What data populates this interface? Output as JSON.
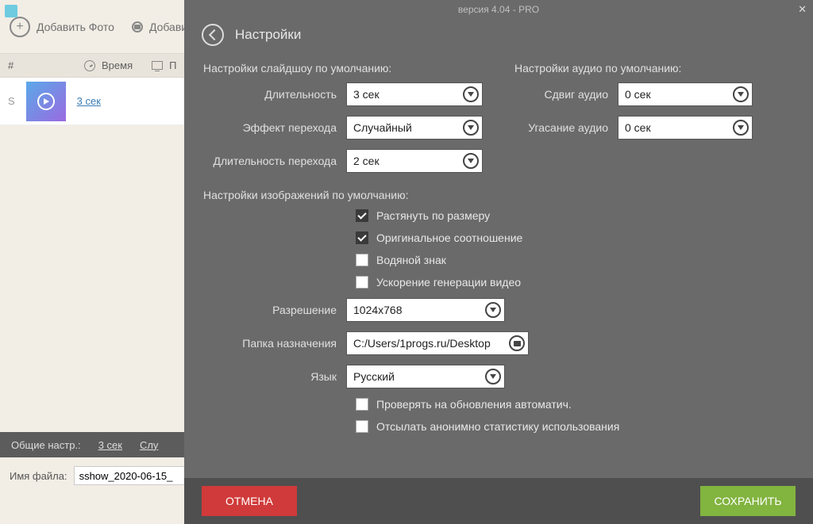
{
  "titlebar": {
    "version": "версия 4.04 - PRO"
  },
  "header": {
    "title": "Настройки"
  },
  "background": {
    "toolbar": {
      "add_photo": "Добавить Фото",
      "add_other": "Добавит"
    },
    "table": {
      "hash": "#",
      "time_hdr": "Время",
      "mon_hdr": "П",
      "row_num": "S",
      "row_time": "3 сек"
    },
    "bottombar": {
      "label": "Общие настр.:",
      "val1": "3 сек",
      "val2": "Слу"
    },
    "filerow": {
      "label": "Имя файла:",
      "value": "sshow_2020-06-15_"
    }
  },
  "sections": {
    "slideshow_title": "Настройки слайдшоу по умолчанию:",
    "audio_title": "Настройки аудио по умолчанию:",
    "images_title": "Настройки изображений по умолчанию:"
  },
  "labels": {
    "duration": "Длительность",
    "transition_effect": "Эффект перехода",
    "transition_duration": "Длительность перехода",
    "audio_shift": "Сдвиг аудио",
    "audio_fade": "Угасание аудио",
    "resolution": "Разрешение",
    "dest_folder": "Папка назначения",
    "language": "Язык"
  },
  "values": {
    "duration": "3 сек",
    "transition_effect": "Случайный",
    "transition_duration": "2 сек",
    "audio_shift": "0 сек",
    "audio_fade": "0 сек",
    "resolution": "1024x768",
    "dest_folder": "C:/Users/1progs.ru/Desktop",
    "language": "Русский"
  },
  "checks": {
    "stretch": {
      "label": "Растянуть по размеру",
      "on": true
    },
    "original_ratio": {
      "label": "Оригинальное соотношение",
      "on": true
    },
    "watermark": {
      "label": "Водяной знак",
      "on": false
    },
    "accel": {
      "label": "Ускорение генерации видео",
      "on": false
    },
    "updates": {
      "label": "Проверять на обновления автоматич.",
      "on": false
    },
    "stats": {
      "label": "Отсылать анонимно статистику использования",
      "on": false
    }
  },
  "buttons": {
    "cancel": "ОТМЕНА",
    "save": "СОХРАНИТЬ"
  }
}
